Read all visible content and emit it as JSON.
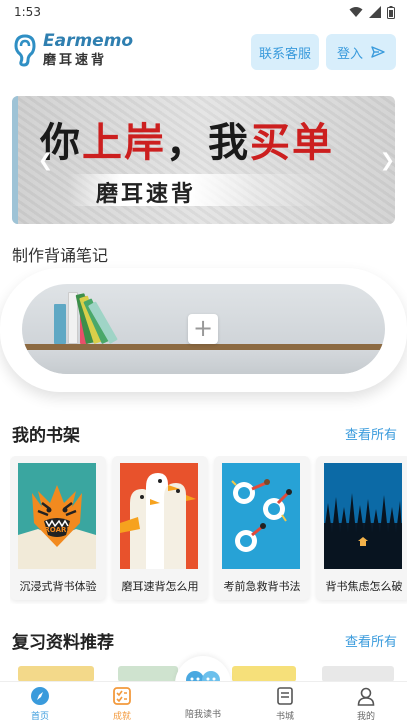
{
  "status": {
    "time": "1:53"
  },
  "header": {
    "logo_en": "Earmemo",
    "logo_cn": "磨耳速背",
    "service_label": "联系客服",
    "login_label": "登入"
  },
  "banner": {
    "line1_a": "你",
    "line1_b": "上岸",
    "line1_c": "，我",
    "line1_d": "买单",
    "line2": "磨耳速背"
  },
  "notes": {
    "title": "制作背诵笔记",
    "add_symbol": "+"
  },
  "shelf": {
    "title": "我的书架",
    "see_all": "查看所有",
    "books": [
      {
        "title": "沉浸式背书体验",
        "cover": "tiger"
      },
      {
        "title": "磨耳速背怎么用",
        "cover": "birds"
      },
      {
        "title": "考前急救背书法",
        "cover": "pool"
      },
      {
        "title": "背书焦虑怎么破",
        "cover": "forest"
      }
    ]
  },
  "review": {
    "title": "复习资料推荐",
    "see_all": "查看所有"
  },
  "tabs": [
    {
      "label": "首页",
      "icon": "compass-icon"
    },
    {
      "label": "成就",
      "icon": "checklist-icon"
    },
    {
      "label": "陪我读书",
      "icon": "companions-icon"
    },
    {
      "label": "书城",
      "icon": "book-icon"
    },
    {
      "label": "我的",
      "icon": "user-icon"
    }
  ],
  "colors": {
    "accent": "#3a9bdc",
    "red": "#cc1f1f",
    "orange": "#f39a3d"
  }
}
